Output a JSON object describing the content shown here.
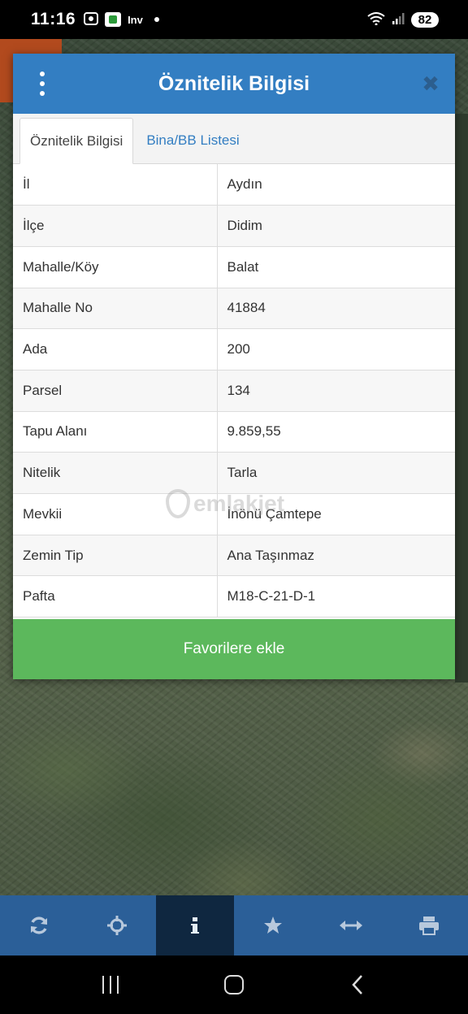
{
  "status_bar": {
    "time": "11:16",
    "carrier_text": "Inv",
    "battery": "82"
  },
  "dialog": {
    "title": "Öznitelik Bilgisi",
    "tabs": [
      {
        "label": "Öznitelik Bilgisi",
        "active": true
      },
      {
        "label": "Bina/BB Listesi",
        "active": false
      }
    ],
    "rows": [
      {
        "key": "İl",
        "value": "Aydın"
      },
      {
        "key": "İlçe",
        "value": "Didim"
      },
      {
        "key": "Mahalle/Köy",
        "value": "Balat"
      },
      {
        "key": "Mahalle No",
        "value": "41884"
      },
      {
        "key": "Ada",
        "value": "200"
      },
      {
        "key": "Parsel",
        "value": "134"
      },
      {
        "key": "Tapu Alanı",
        "value": "9.859,55"
      },
      {
        "key": "Nitelik",
        "value": "Tarla"
      },
      {
        "key": "Mevkii",
        "value": "İnönü Çamtepe"
      },
      {
        "key": "Zemin Tip",
        "value": "Ana Taşınmaz"
      },
      {
        "key": "Pafta",
        "value": "M18-C-21-D-1"
      }
    ],
    "favorite_button": "Favorilere ekle"
  },
  "watermark": "emlakjet",
  "toolbar": {
    "items": [
      "refresh-icon",
      "crosshair-icon",
      "info-icon",
      "star-icon",
      "measure-icon",
      "print-icon"
    ],
    "active_index": 2
  },
  "colors": {
    "header": "#337ec2",
    "favorite": "#5cb85c",
    "toolbar": "#2b5f98",
    "toolbar_active": "#0f2740"
  }
}
